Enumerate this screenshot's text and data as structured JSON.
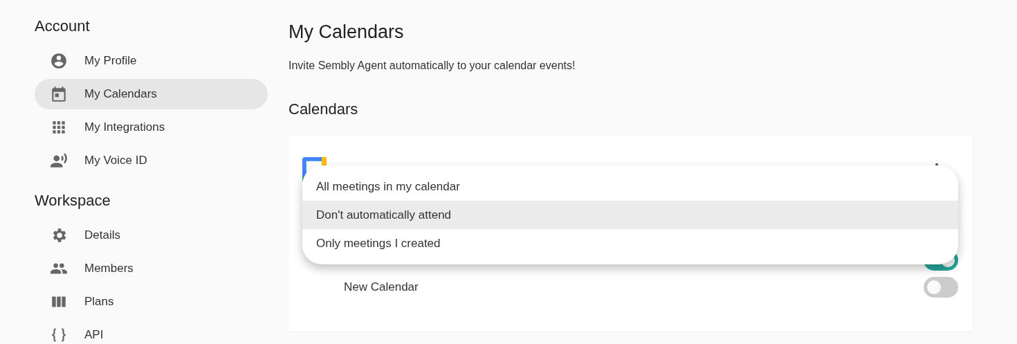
{
  "sidebar": {
    "sections": [
      {
        "title": "Account",
        "items": [
          {
            "label": "My Profile",
            "kind": "person",
            "selected": false
          },
          {
            "label": "My Calendars",
            "kind": "calendar",
            "selected": true
          },
          {
            "label": "My Integrations",
            "kind": "grid",
            "selected": false
          },
          {
            "label": "My Voice ID",
            "kind": "voice",
            "selected": false
          }
        ]
      },
      {
        "title": "Workspace",
        "items": [
          {
            "label": "Details",
            "kind": "gear",
            "selected": false
          },
          {
            "label": "Members",
            "kind": "people",
            "selected": false
          },
          {
            "label": "Plans",
            "kind": "columns",
            "selected": false
          },
          {
            "label": "API",
            "kind": "braces",
            "selected": false
          }
        ]
      }
    ]
  },
  "page": {
    "title": "My Calendars",
    "subtitle": "Invite Sembly Agent automatically to your calendar events!",
    "section_title": "Calendars"
  },
  "calendars": [
    {
      "on": true
    },
    {
      "name": "New Calendar",
      "on": false
    }
  ],
  "menu": {
    "options": [
      {
        "label": "All meetings in my calendar",
        "selected": false
      },
      {
        "label": "Don't automatically attend",
        "selected": true
      },
      {
        "label": "Only meetings I created",
        "selected": false
      }
    ]
  }
}
